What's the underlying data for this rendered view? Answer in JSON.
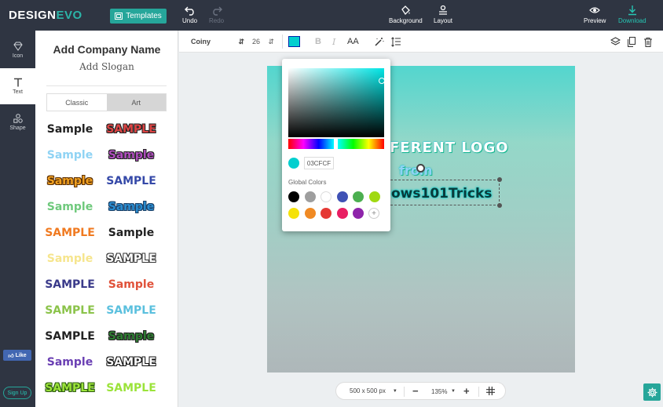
{
  "app": {
    "logo_part1": "DESIGN",
    "logo_part2": "EVO",
    "templates": "Templates"
  },
  "toolbar": {
    "undo": "Undo",
    "redo": "Redo",
    "background": "Background",
    "layout": "Layout",
    "preview": "Preview",
    "download": "Download"
  },
  "rail": {
    "icon": "Icon",
    "text": "Text",
    "shape": "Shape",
    "like": "Like",
    "signup": "Sign Up"
  },
  "panel": {
    "company": "Add Company Name",
    "slogan": "Add Slogan",
    "tab_classic": "Classic",
    "tab_art": "Art",
    "samples": [
      {
        "text": "Sample",
        "color": "#222",
        "stroke": "#fff"
      },
      {
        "text": "SAMPLE",
        "color": "#d44",
        "stroke": "#222"
      },
      {
        "text": "Sample",
        "color": "#8fd3f4",
        "stroke": "#fff"
      },
      {
        "text": "Sample",
        "color": "#b04fbf",
        "stroke": "#222"
      },
      {
        "text": "Sample",
        "color": "#f0a020",
        "stroke": "#5a2d00"
      },
      {
        "text": "SAMPLE",
        "color": "#3549a8",
        "stroke": "#fff"
      },
      {
        "text": "Sample",
        "color": "#6fc97c",
        "stroke": "#fff"
      },
      {
        "text": "Sample",
        "color": "#2a8ccf",
        "stroke": "#1a3f66"
      },
      {
        "text": "SAMPLE",
        "color": "#f07a20",
        "stroke": "#fff"
      },
      {
        "text": "Sample",
        "color": "#222",
        "stroke": "#fff"
      },
      {
        "text": "Sample",
        "color": "#f6e58d",
        "stroke": "#fff"
      },
      {
        "text": "SAMPLE",
        "color": "#fff",
        "stroke": "#333"
      },
      {
        "text": "SAMPLE",
        "color": "#3a3a8a",
        "stroke": "#fff"
      },
      {
        "text": "Sample",
        "color": "#e0523a",
        "stroke": "#fff"
      },
      {
        "text": "SAMPLE",
        "color": "#8bc34a",
        "stroke": "#fff"
      },
      {
        "text": "SAMPLE",
        "color": "#5bc0de",
        "stroke": "#fff"
      },
      {
        "text": "SAMPLE",
        "color": "#222",
        "stroke": "#fff"
      },
      {
        "text": "Sample",
        "color": "#2e7d32",
        "stroke": "#222"
      },
      {
        "text": "Sample",
        "color": "#6a3fb3",
        "stroke": "#fff"
      },
      {
        "text": "SAMPLE",
        "color": "#fff",
        "stroke": "#111"
      },
      {
        "text": "SAMPLE",
        "color": "#9be33a",
        "stroke": "#2e5d10"
      },
      {
        "text": "SAMPLE",
        "color": "#9be33a",
        "stroke": "#fff"
      }
    ]
  },
  "format": {
    "font": "Coiny",
    "size": "26",
    "bold": "B",
    "italic": "I",
    "case": "AA"
  },
  "canvas": {
    "line1": "FERENT LOGO",
    "line2": "from",
    "line3": "ows101Tricks"
  },
  "picker": {
    "hex": "03CFCF",
    "global_label": "Global Colors",
    "swatches": [
      "#000000",
      "#9e9e9e",
      "#ffffff",
      "#3f51b5",
      "#4caf50",
      "#a0d911",
      "#f5e20a",
      "#f08a24",
      "#e53935",
      "#e91e63",
      "#8e24aa"
    ]
  },
  "zoom": {
    "size": "500 x 500 px",
    "value": "135%",
    "minus": "−",
    "plus": "+"
  },
  "colors": {
    "accent": "#26a69a",
    "dark": "#2f3542",
    "current": "#03cfcf"
  }
}
